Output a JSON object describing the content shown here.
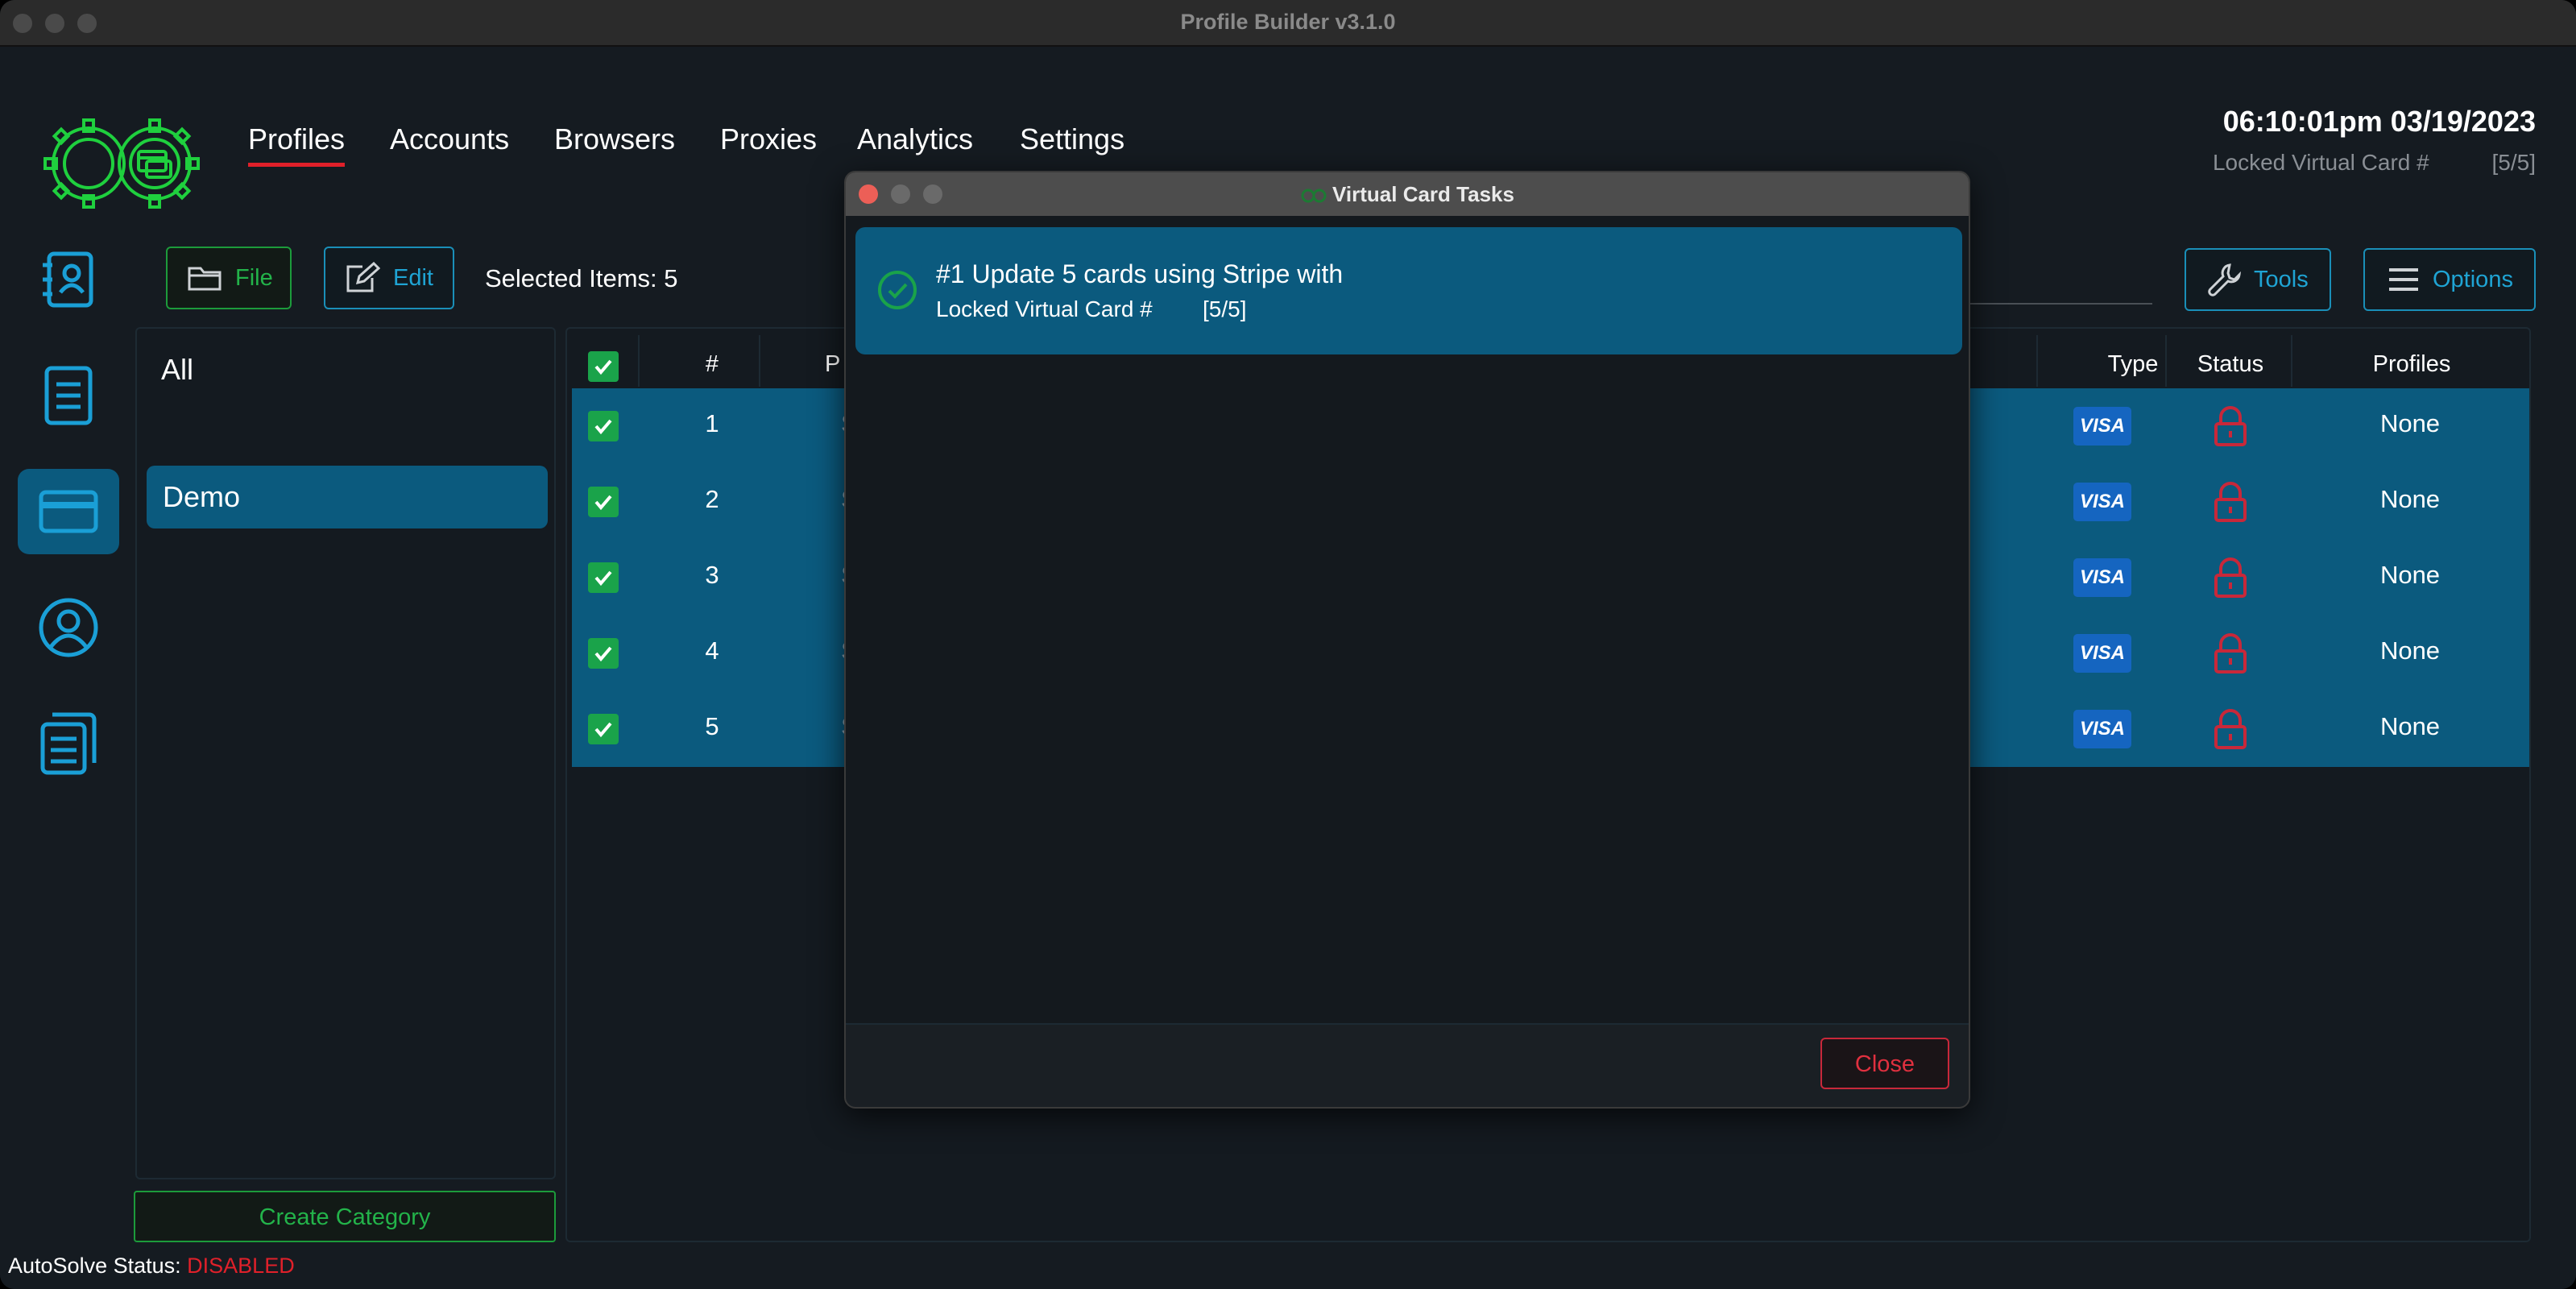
{
  "window": {
    "title": "Profile Builder v3.1.0"
  },
  "nav": {
    "items": [
      {
        "label": "Profiles",
        "active": true
      },
      {
        "label": "Accounts"
      },
      {
        "label": "Browsers"
      },
      {
        "label": "Proxies"
      },
      {
        "label": "Analytics"
      },
      {
        "label": "Settings"
      }
    ]
  },
  "header": {
    "datetime": "06:10:01pm 03/19/2023",
    "locked_label": "Locked Virtual Card #",
    "locked_count": "[5/5]"
  },
  "sidebar": {
    "icons": [
      "contacts-book-icon",
      "document-icon",
      "credit-card-icon",
      "user-circle-icon",
      "copy-documents-icon"
    ],
    "active_index": 2
  },
  "toolbar": {
    "file_label": "File",
    "edit_label": "Edit",
    "selected_items": "Selected Items: 5",
    "tools_label": "Tools",
    "options_label": "Options"
  },
  "categories": {
    "all_label": "All",
    "items": [
      {
        "label": "Demo",
        "selected": true
      }
    ],
    "create_label": "Create Category"
  },
  "table": {
    "headers": {
      "num": "#",
      "p": "P",
      "type": "Type",
      "status": "Status",
      "profiles": "Profiles"
    },
    "rows": [
      {
        "num": "1",
        "trunc": "S",
        "type": "VISA",
        "status": "locked",
        "profiles": "None"
      },
      {
        "num": "2",
        "trunc": "S",
        "type": "VISA",
        "status": "locked",
        "profiles": "None"
      },
      {
        "num": "3",
        "trunc": "S",
        "type": "VISA",
        "status": "locked",
        "profiles": "None"
      },
      {
        "num": "4",
        "trunc": "S",
        "type": "VISA",
        "status": "locked",
        "profiles": "None"
      },
      {
        "num": "5",
        "trunc": "S",
        "type": "VISA",
        "status": "locked",
        "profiles": "None"
      }
    ]
  },
  "footer": {
    "autosolve_label": "AutoSolve Status:",
    "autosolve_value": "DISABLED"
  },
  "modal": {
    "title": "Virtual Card Tasks",
    "task": {
      "title": "#1 Update 5 cards using Stripe with",
      "sub_label": "Locked Virtual Card #",
      "sub_count": "[5/5]",
      "status": "complete"
    },
    "close_label": "Close"
  },
  "colors": {
    "accent_blue": "#0b5a7e",
    "green": "#1aa34a",
    "red": "#e0202a",
    "cyan": "#1fa4d4"
  }
}
